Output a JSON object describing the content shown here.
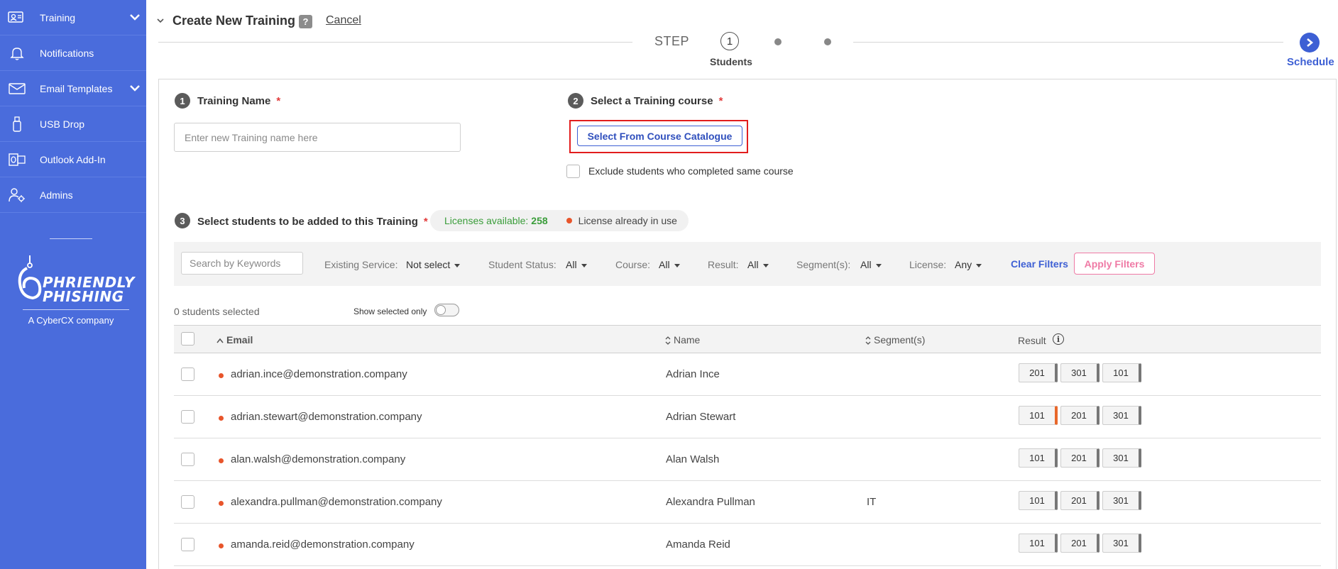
{
  "sidebar": {
    "items": [
      {
        "label": "Training",
        "icon": "training-icon",
        "has_caret": true
      },
      {
        "label": "Notifications",
        "icon": "bell-icon",
        "has_caret": false
      },
      {
        "label": "Email Templates",
        "icon": "email-icon",
        "has_caret": true
      },
      {
        "label": "USB Drop",
        "icon": "usb-icon",
        "has_caret": false
      },
      {
        "label": "Outlook Add-In",
        "icon": "outlook-icon",
        "has_caret": false
      },
      {
        "label": "Admins",
        "icon": "admins-icon",
        "has_caret": false
      }
    ],
    "logo": {
      "word1": "PHRIENDLY",
      "word2": "PHISHING",
      "tagline": "A CyberCX company"
    },
    "bg_color": "#4a6cdc"
  },
  "header": {
    "title": "Create New Training",
    "help": "?",
    "cancel": "Cancel"
  },
  "stepper": {
    "step_word": "STEP",
    "current_step": "1",
    "current_label": "Students",
    "final_label": "Schedule"
  },
  "form": {
    "section1": {
      "number": "1",
      "label": "Training Name",
      "required": "*",
      "placeholder": "Enter new Training name here",
      "value": ""
    },
    "section2": {
      "number": "2",
      "label": "Select a Training course",
      "required": "*",
      "button": "Select From Course Catalogue",
      "exclude_label": "Exclude students who completed same course"
    },
    "section3": {
      "number": "3",
      "label": "Select students to be added to this Training",
      "required": "*"
    }
  },
  "licenses": {
    "available_label": "Licenses available:",
    "available_count": "258",
    "in_use_label": "License already in use"
  },
  "filters": {
    "search_placeholder": "Search by Keywords",
    "existing_service": {
      "label": "Existing Service:",
      "value": "Not select"
    },
    "student_status": {
      "label": "Student Status:",
      "value": "All"
    },
    "course": {
      "label": "Course:",
      "value": "All"
    },
    "result": {
      "label": "Result:",
      "value": "All"
    },
    "segments": {
      "label": "Segment(s):",
      "value": "All"
    },
    "license": {
      "label": "License:",
      "value": "Any"
    },
    "clear": "Clear Filters",
    "apply": "Apply Filters"
  },
  "selection": {
    "count_text": "0 students selected",
    "show_selected_label": "Show selected only"
  },
  "table": {
    "columns": {
      "email": "Email",
      "name": "Name",
      "segments": "Segment(s)",
      "result": "Result"
    },
    "rows": [
      {
        "email": "adrian.ince@demonstration.company",
        "name": "Adrian Ince",
        "segment": "",
        "results": [
          "201",
          "301",
          "101"
        ],
        "orange_chip": -1
      },
      {
        "email": "adrian.stewart@demonstration.company",
        "name": "Adrian Stewart",
        "segment": "",
        "results": [
          "101",
          "201",
          "301"
        ],
        "orange_chip": 0
      },
      {
        "email": "alan.walsh@demonstration.company",
        "name": "Alan Walsh",
        "segment": "",
        "results": [
          "101",
          "201",
          "301"
        ],
        "orange_chip": -1
      },
      {
        "email": "alexandra.pullman@demonstration.company",
        "name": "Alexandra Pullman",
        "segment": "IT",
        "results": [
          "101",
          "201",
          "301"
        ],
        "orange_chip": -1
      },
      {
        "email": "amanda.reid@demonstration.company",
        "name": "Amanda Reid",
        "segment": "",
        "results": [
          "101",
          "201",
          "301"
        ],
        "orange_chip": -1
      }
    ]
  },
  "colors": {
    "accent": "#3d5fd4",
    "required": "#e23b3b",
    "licenses_green": "#3a9d3a",
    "status_dot": "#e8552b",
    "apply_pink": "#ef7aa5",
    "highlight_red": "#e21d1d"
  }
}
